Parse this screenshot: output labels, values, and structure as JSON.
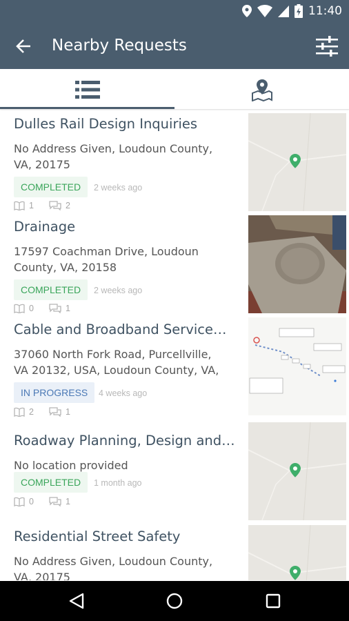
{
  "status_bar": {
    "time": "11:40"
  },
  "app_bar": {
    "title": "Nearby Requests"
  },
  "colors": {
    "primary": "#4a5d6e",
    "completed": "#3aa55a",
    "in_progress": "#4a78b5",
    "map_pin": "#3fae6a"
  },
  "tabs": [
    {
      "icon": "list-icon",
      "selected": true
    },
    {
      "icon": "map-marker-icon",
      "selected": false
    }
  ],
  "requests": [
    {
      "title": "Dulles Rail Design Inquiries",
      "address": "No Address Given, Loudoun County, VA, 20175",
      "status": "COMPLETED",
      "age": "2 weeks ago",
      "supports": "1",
      "comments": "2",
      "thumbnail": "map-thumbnail"
    },
    {
      "title": "Drainage",
      "address": "17597 Coachman Drive, Loudoun County, VA, 20158",
      "status": "COMPLETED",
      "age": "2 weeks ago",
      "supports": "0",
      "comments": "1",
      "thumbnail": "photo-thumbnail"
    },
    {
      "title": "Cable and Broadband Service…",
      "address": "37060 North Fork Road, Purcellville, VA 20132, USA, Loudoun County, VA,",
      "status": "IN PROGRESS",
      "age": "4 weeks ago",
      "supports": "2",
      "comments": "1",
      "thumbnail": "diagram-thumbnail"
    },
    {
      "title": "Roadway Planning, Design and…",
      "address": "No location provided",
      "status": "COMPLETED",
      "age": "1 month ago",
      "supports": "0",
      "comments": "1",
      "thumbnail": "map-thumbnail"
    },
    {
      "title": "Residential Street Safety",
      "address": "No Address Given, Loudoun County, VA, 20175",
      "status": "",
      "age": "",
      "supports": "",
      "comments": "",
      "thumbnail": "map-thumbnail"
    }
  ],
  "nav_bar": {
    "icons": [
      "back-triangle-icon",
      "home-circle-icon",
      "recents-square-icon"
    ]
  }
}
